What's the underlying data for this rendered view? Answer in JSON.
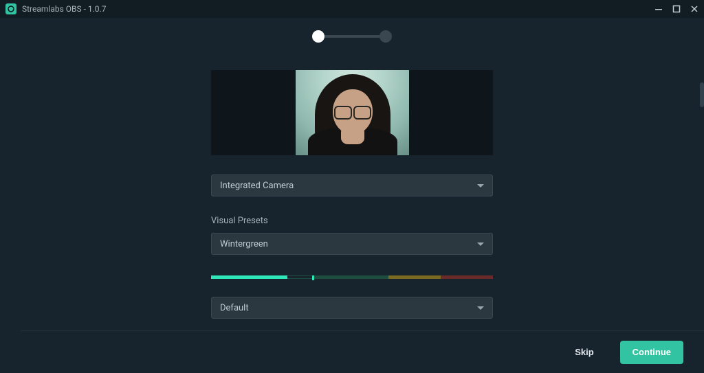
{
  "titlebar": {
    "app_name": "Streamlabs OBS - 1.0.7"
  },
  "setup": {
    "camera_select": "Integrated Camera",
    "visual_presets_label": "Visual Presets",
    "preset_select": "Wintergreen",
    "mic_select": "Default"
  },
  "footer": {
    "skip_label": "Skip",
    "continue_label": "Continue"
  }
}
